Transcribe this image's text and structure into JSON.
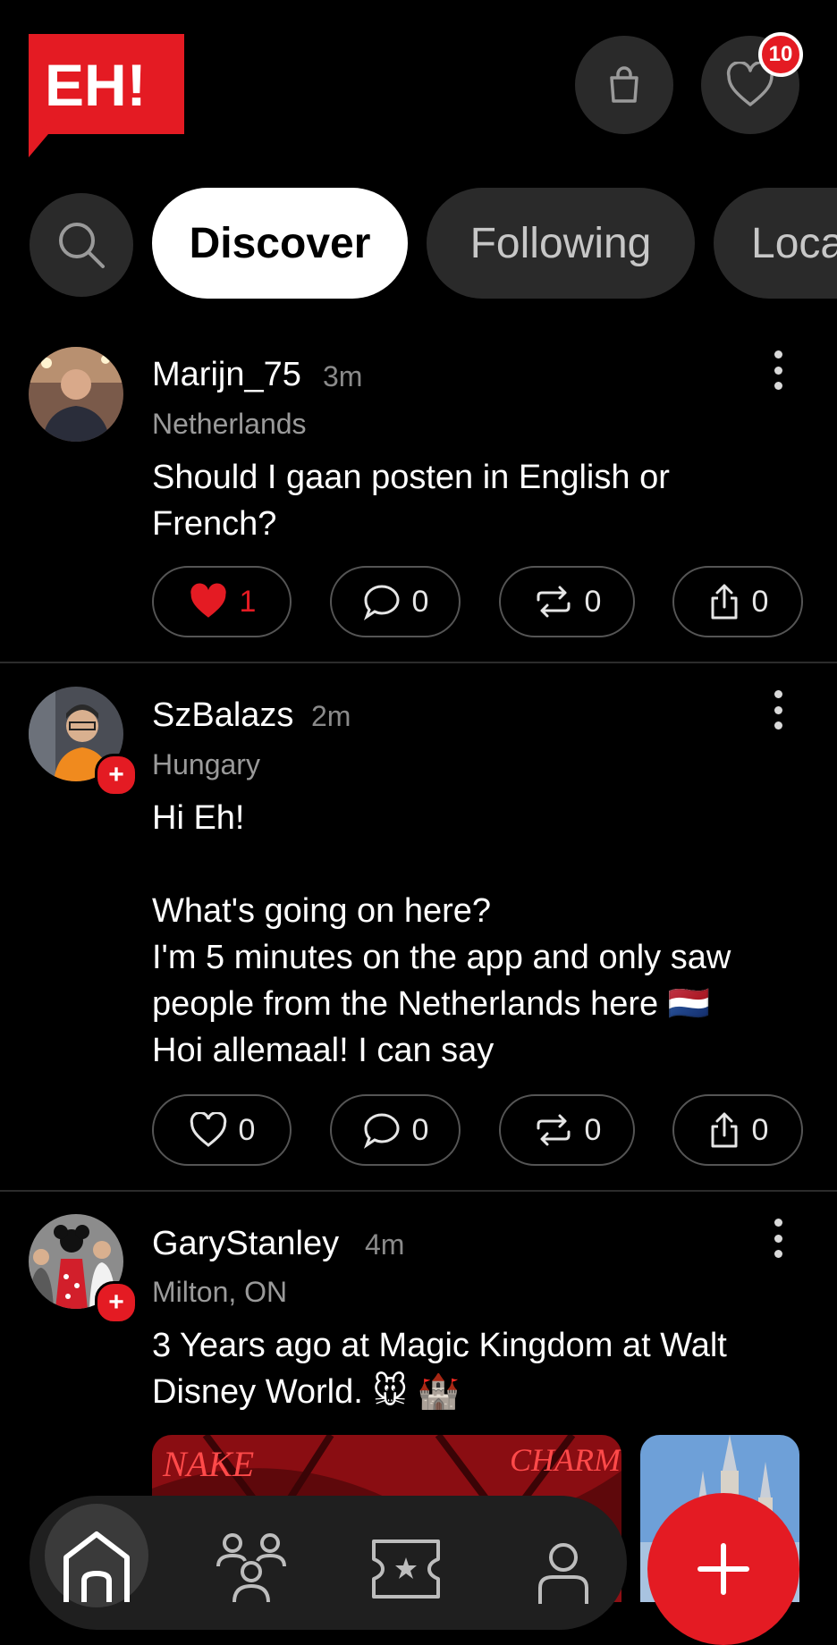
{
  "header": {
    "logo_text": "EH!",
    "notification_count": "10"
  },
  "tabs": [
    {
      "label": "Discover",
      "active": true
    },
    {
      "label": "Following",
      "active": false
    },
    {
      "label": "Loca",
      "active": false
    }
  ],
  "posts": [
    {
      "username": "Marijn_75",
      "time": "3m",
      "location": "Netherlands",
      "text": "Should I gaan posten in English or\nFrench?",
      "liked": true,
      "likes": "1",
      "comments": "0",
      "reposts": "0",
      "shares": "0"
    },
    {
      "username": "SzBalazs",
      "time": "2m",
      "location": "Hungary",
      "text": "Hi Eh!\n\nWhat's going on here?\nI'm 5 minutes on the app and only saw\npeople from the Netherlands here 🇳🇱\nHoi allemaal! I can say",
      "liked": false,
      "likes": "0",
      "comments": "0",
      "reposts": "0",
      "shares": "0"
    },
    {
      "username": "GaryStanley",
      "time": "4m",
      "location": "Milton, ON",
      "text": "3 Years ago at Magic Kingdom at Walt\nDisney World. 🐭 🏰",
      "media_text_left": "NAKE",
      "media_text_right": "CHARM"
    }
  ],
  "colors": {
    "accent": "#e41b23",
    "background": "#000000",
    "surface": "#2a2a2a"
  },
  "icons": [
    "search-icon",
    "bag-icon",
    "heart-icon",
    "comment-icon",
    "repost-icon",
    "share-icon",
    "more-icon",
    "home-icon",
    "people-icon",
    "ticket-icon",
    "profile-icon",
    "plus-icon"
  ]
}
